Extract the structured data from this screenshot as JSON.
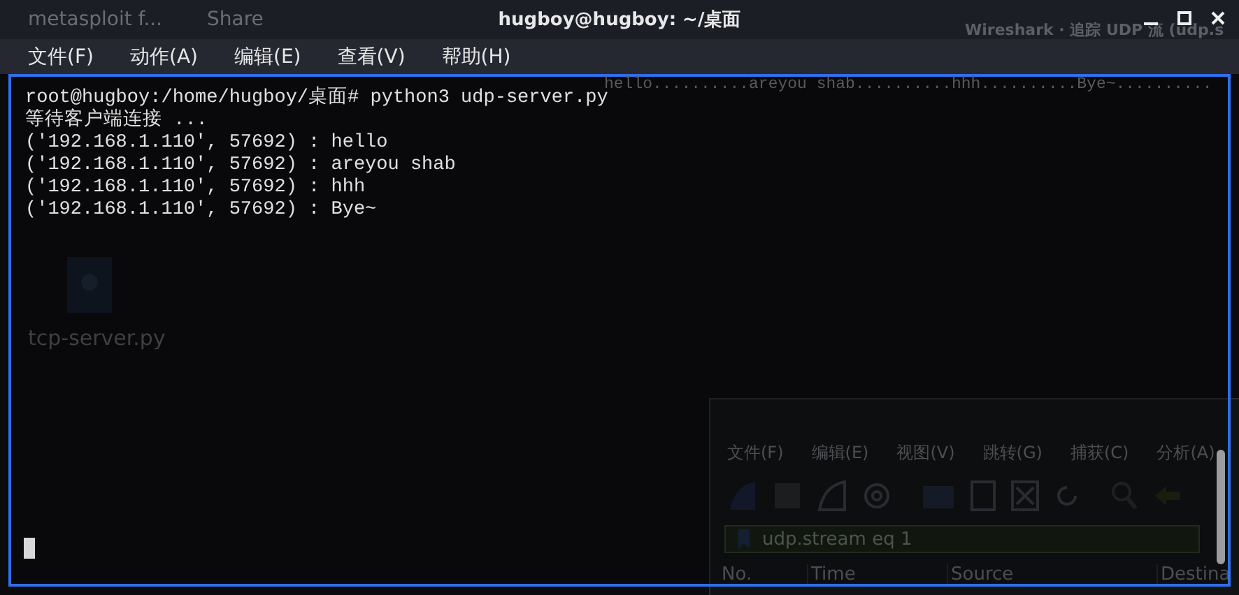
{
  "window": {
    "title": "hugboy@hugboy: ~/桌面"
  },
  "menu": [
    "文件(F)",
    "动作(A)",
    "编辑(E)",
    "查看(V)",
    "帮助(H)"
  ],
  "terminal": {
    "lines": [
      "root@hugboy:/home/hugboy/桌面# python3 udp-server.py",
      "等待客户端连接 ...",
      "('192.168.1.110', 57692) : hello",
      "('192.168.1.110', 57692) : areyou shab",
      "('192.168.1.110', 57692) : hhh",
      "('192.168.1.110', 57692) : Bye~"
    ],
    "cursor": true
  },
  "background": {
    "tabs": [
      "metasploit f...",
      "Share"
    ],
    "desktop_icon": {
      "label": "tcp-server.py"
    },
    "stream_text": "hello..........areyou shab..........hhh..........Bye~..........",
    "wireshark": {
      "title": "Wireshark · 追踪 UDP 流 (udp.s",
      "menu": [
        "文件(F)",
        "编辑(E)",
        "视图(V)",
        "跳转(G)",
        "捕获(C)",
        "分析(A)"
      ],
      "filter": "udp.stream eq 1",
      "columns": [
        "No.",
        "Time",
        "Source",
        "Destina"
      ]
    }
  }
}
